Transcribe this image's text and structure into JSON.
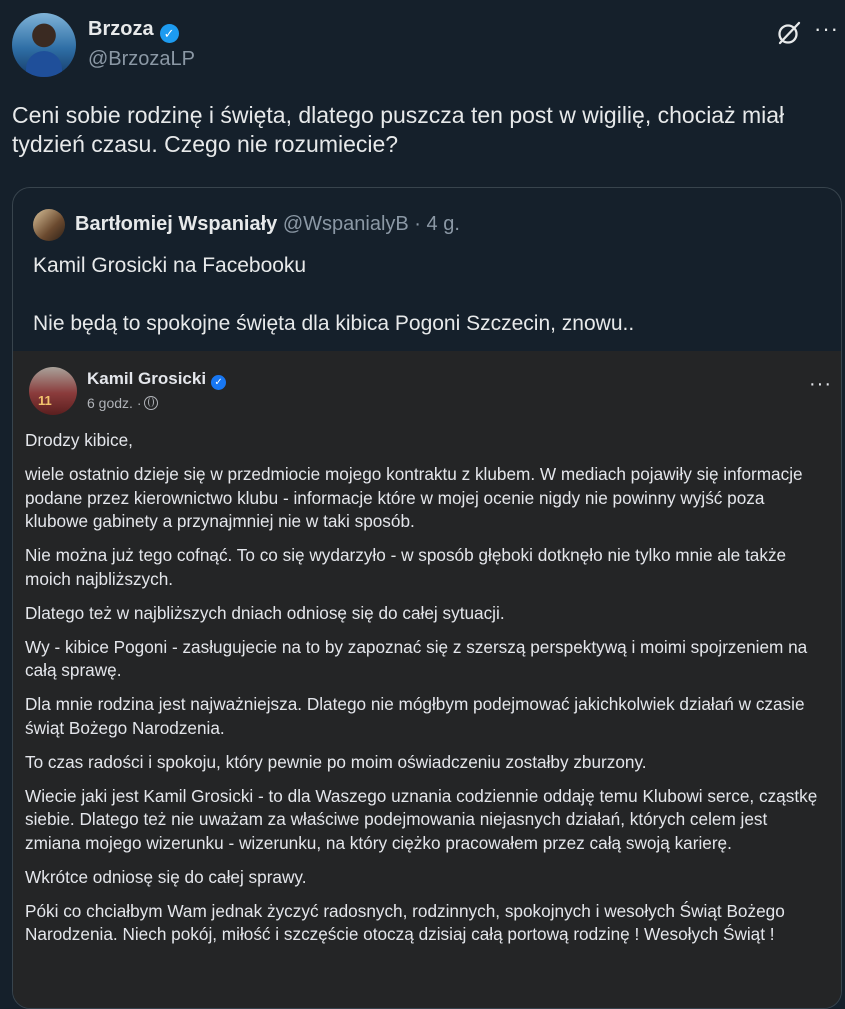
{
  "tweet": {
    "author_name": "Brzoza",
    "author_handle": "@BrzozaLP",
    "text": "Ceni sobie rodzinę i święta, dlatego puszcza ten post w wigilię, chociaż miał tydzień czasu. Czego nie rozumiecie?",
    "icons": {
      "grok": "grok-icon",
      "more": "more-icon"
    },
    "more_glyph": "···"
  },
  "quote": {
    "author_name": "Bartłomiej Wspaniały",
    "author_handle": "@WspanialyB",
    "separator": " · ",
    "time": "4 g.",
    "line1": "Kamil Grosicki na Facebooku",
    "line2": "Nie będą to spokojne święta dla kibica Pogoni Szczecin, znowu..",
    "facebook_post": {
      "author_name": "Kamil Grosicki",
      "time": "6 godz. ·",
      "more_glyph": "···",
      "paragraphs": [
        "Drodzy kibice,",
        "wiele ostatnio dzieje się w przedmiocie mojego kontraktu z klubem. W mediach pojawiły się informacje podane przez kierownictwo klubu - informacje które w mojej ocenie nigdy nie powinny wyjść poza klubowe gabinety a przynajmniej nie w taki sposób.",
        "Nie można już tego cofnąć. To co się wydarzyło - w sposób głęboki dotknęło nie tylko mnie ale także moich najbliższych.",
        "Dlatego też w najbliższych dniach odniosę się do całej sytuacji.",
        "Wy - kibice Pogoni - zasługujecie na to by zapoznać się z szerszą perspektywą i moimi spojrzeniem na całą sprawę.",
        "Dla mnie rodzina jest najważniejsza. Dlatego nie mógłbym podejmować jakichkolwiek działań w czasie świąt Bożego Narodzenia.",
        "To czas radości i spokoju, który pewnie po moim oświadczeniu zostałby zburzony.",
        "Wiecie jaki jest Kamil Grosicki - to dla Waszego uznania codziennie oddaję temu Klubowi serce, cząstkę siebie. Dlatego też nie uważam za właściwe podejmowania niejasnych działań, których celem jest zmiana mojego wizerunku - wizerunku, na który ciężko pracowałem przez całą swoją karierę.",
        "Wkrótce odniosę się do całej sprawy.",
        "Póki co chciałbym Wam jednak życzyć radosnych, rodzinnych, spokojnych i wesołych Świąt Bożego Narodzenia. Niech pokój, miłość i szczęście otoczą dzisiaj całą portową rodzinę ! Wesołych Świąt !"
      ]
    }
  },
  "colors": {
    "background": "#15202b",
    "verified_x": "#1d9bf0",
    "verified_fb": "#1877f2",
    "fb_background": "#242526"
  }
}
